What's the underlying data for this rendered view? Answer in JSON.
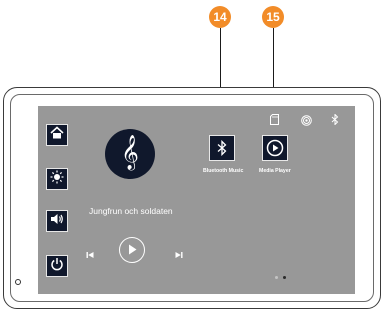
{
  "callouts": [
    {
      "number": "14",
      "color": "#f28c28"
    },
    {
      "number": "15",
      "color": "#f28c28"
    }
  ],
  "sidebar": {
    "items": [
      {
        "icon": "home-icon"
      },
      {
        "icon": "brightness-icon"
      },
      {
        "icon": "volume-icon"
      },
      {
        "icon": "power-icon"
      }
    ]
  },
  "now_playing": {
    "song_title": "Jungfrun och soldaten",
    "album_art_icon": "treble-clef-icon"
  },
  "apps": [
    {
      "label": "Bluetooth Music",
      "icon": "bluetooth-icon"
    },
    {
      "label": "Media Player",
      "icon": "play-icon"
    }
  ],
  "status_bar": {
    "icons": [
      "sd-card-icon",
      "wireless-icon",
      "bluetooth-status-icon"
    ]
  },
  "pager": {
    "pages": 2,
    "active": 2
  },
  "colors": {
    "screen_bg": "#989898",
    "tile_bg": "#10182c",
    "callout": "#f28c28"
  }
}
